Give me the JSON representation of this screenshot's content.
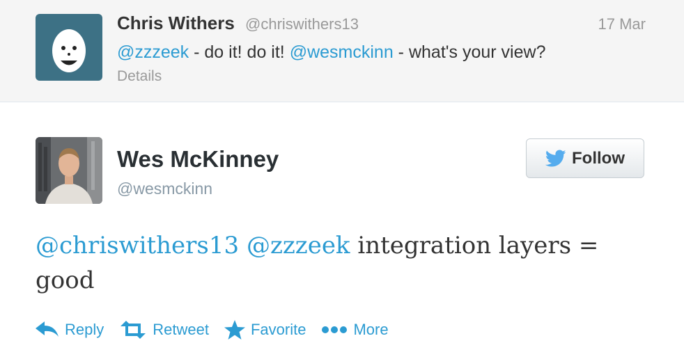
{
  "parent_tweet": {
    "name": "Chris Withers",
    "handle": "@chriswithers13",
    "time": "17 Mar",
    "text_mention_1": "@zzzeek",
    "text_mid": " - do it! do it! ",
    "text_mention_2": "@wesmckinn",
    "text_end": " - what's your view?",
    "details_label": "Details"
  },
  "main_tweet": {
    "name": "Wes McKinney",
    "handle": "@wesmckinn",
    "follow_label": "Follow",
    "text_mention_1": "@chriswithers13",
    "text_mention_2": "@zzzeek",
    "text_rest": " integration layers = good"
  },
  "actions": {
    "reply": "Reply",
    "retweet": "Retweet",
    "favorite": "Favorite",
    "more": "More"
  },
  "colors": {
    "link": "#2b9bd2",
    "twitter_bird": "#55acee",
    "egg_background": "#3d7185"
  }
}
